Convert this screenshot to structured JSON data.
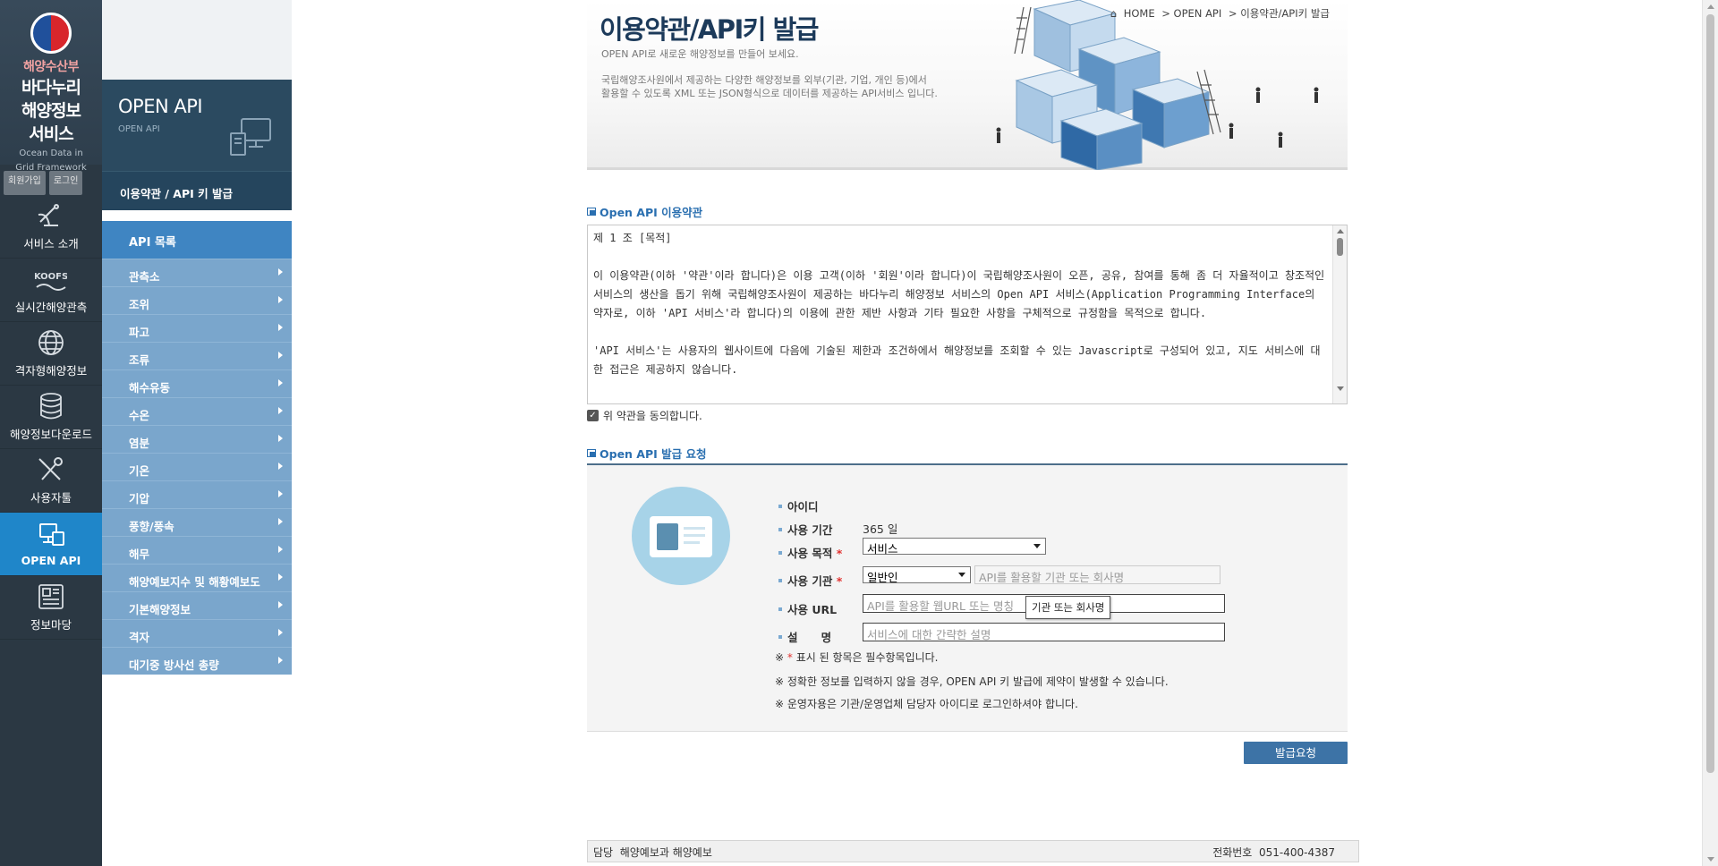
{
  "logo": {
    "ministry": "해양수산부",
    "title_line1": "바다누리",
    "title_line2": "해양정보",
    "title_line3": "서비스",
    "subtitle_line1": "Ocean Data in",
    "subtitle_line2": "Grid Framework"
  },
  "auth": {
    "signup": "회원가입",
    "login": "로그인"
  },
  "iconnav": [
    {
      "label": "서비스 소개",
      "icon": "satellite-icon"
    },
    {
      "label": "실시간해양관측",
      "icon": "koofs-icon",
      "icon_text": "KOOFS"
    },
    {
      "label": "격자형해양정보",
      "icon": "globe-icon"
    },
    {
      "label": "해양정보다운로드",
      "icon": "database-icon"
    },
    {
      "label": "사용자툴",
      "icon": "tools-icon"
    },
    {
      "label": "OPEN API",
      "icon": "monitor-icon",
      "active": true
    },
    {
      "label": "정보마당",
      "icon": "newspaper-icon"
    }
  ],
  "sidebar": {
    "header_title": "OPEN API",
    "header_sub": "OPEN API",
    "current": "이용약관 / API 키 발급",
    "list_title": "API 목록",
    "items": [
      "관측소",
      "조위",
      "파고",
      "조류",
      "해수유동",
      "수온",
      "염분",
      "기온",
      "기압",
      "풍향/풍속",
      "해무",
      "해양예보지수 및 해황예보도",
      "기본해양정보",
      "격자",
      "대기중 방사선 총량"
    ]
  },
  "banner": {
    "title": "이용약관/API키 발급",
    "subtitle": "OPEN API로 새로운 해양정보를 만들어 보세요.",
    "desc_line1": "국립해양조사원에서 제공하는 다양한 해양정보를 외부(기관, 기업, 개인 등)에서",
    "desc_line2": "활용할 수 있도록 XML 또는 JSON형식으로 데이터를 제공하는 API서비스 입니다.",
    "crumbs": [
      "HOME",
      "> OPEN API",
      "> 이용약관/API키 발급"
    ]
  },
  "terms": {
    "section_title": "Open API 이용약관",
    "heading": "제 1 조 [목적]",
    "para1": "이 이용약관(이하 '약관'이라 합니다)은 이용 고객(이하 '회원'이라 합니다)이 국립해양조사원이  오픈, 공유, 참여를 통해 좀 더 자율적이고 창조적인 서비스의 생산을 돕기 위해 국립해양조사원이 제공하는 바다누리 해양정보 서비스의 Open API 서비스(Application Programming Interface의 약자로, 이하 'API 서비스'라 합니다)의 이용에 관한 제반 사항과 기타 필요한 사항을 구체적으로 규정함을 목적으로 합니다.",
    "para2": "'API 서비스'는 사용자의 웹사이트에 다음에 기술된 제한과 조건하에서 해양정보를 조회할 수 있는 Javascript로 구성되어 있고, 지도 서비스에 대한 접근은 제공하지 않습니다.",
    "agree": "위 약관을 동의합니다."
  },
  "form": {
    "section_title": "Open API 발급 요청",
    "id_label": "아이디",
    "period_label": "사용 기간",
    "period_value": "365 일",
    "purpose_label": "사용 목적",
    "purpose_value": "서비스",
    "org_label": "사용 기관",
    "org_type_value": "일반인",
    "org_placeholder": "API를 활용할 기관 또는 회사명",
    "url_label": "사용 URL",
    "url_placeholder": "API를 활용할 웹URL 또는 명칭",
    "desc_label": "설      명",
    "desc_placeholder": "서비스에 대한 간략한 설명",
    "tooltip": "기관 또는 회사명",
    "required_mark": "*",
    "note1_prefix": "※",
    "note1_suffix": "표시 된 항목은 필수항목입니다.",
    "note2": "※ 정확한 정보를 입력하지 않을 경우, OPEN API 키 발급에 제약이 발생할 수 있습니다.",
    "note3": "※ 운영자용은 기관/운영업체 담당자 아이디로 로그인하셔야 합니다.",
    "submit": "발급요청"
  },
  "footer": {
    "left": "담당  해양예보과 해양예보",
    "right": "전화번호  051-400-4387"
  },
  "colors": {
    "accent": "#1f86c9",
    "sidebar_item": "#7aa6cc",
    "required": "#e2312f",
    "submit": "#3d73a6"
  }
}
